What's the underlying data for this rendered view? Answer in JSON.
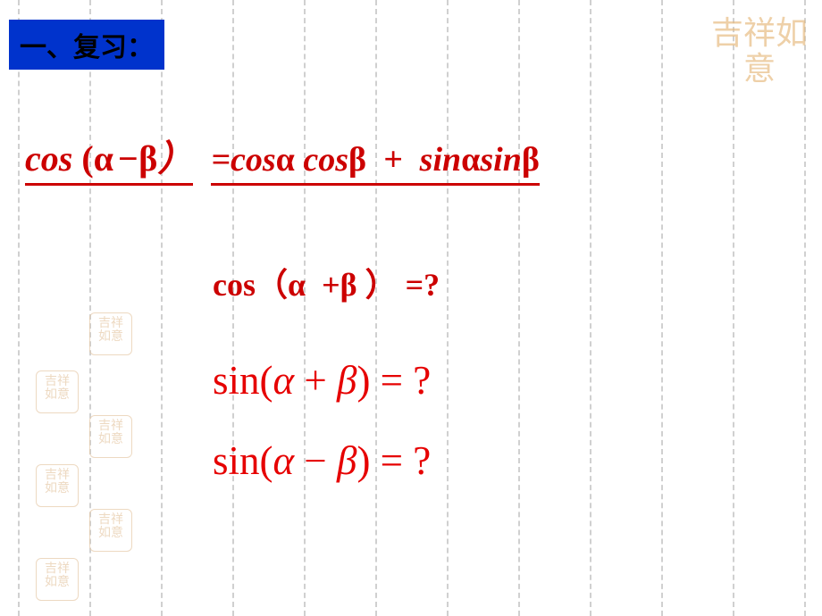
{
  "header": {
    "title": "一、复习："
  },
  "formula": {
    "lhs": "cos (α −β）",
    "rhs": "=cosα cosβ  +  sinαsinβ"
  },
  "questions": {
    "q1": "cos（α  +β ） =?",
    "q2": "sin(α + β) = ?",
    "q3": "sin(α − β) = ?"
  },
  "stamp_text": "吉祥如意",
  "grid": {
    "positions": [
      20,
      100,
      180,
      260,
      340,
      420,
      500,
      580,
      660,
      740,
      820,
      900
    ]
  }
}
